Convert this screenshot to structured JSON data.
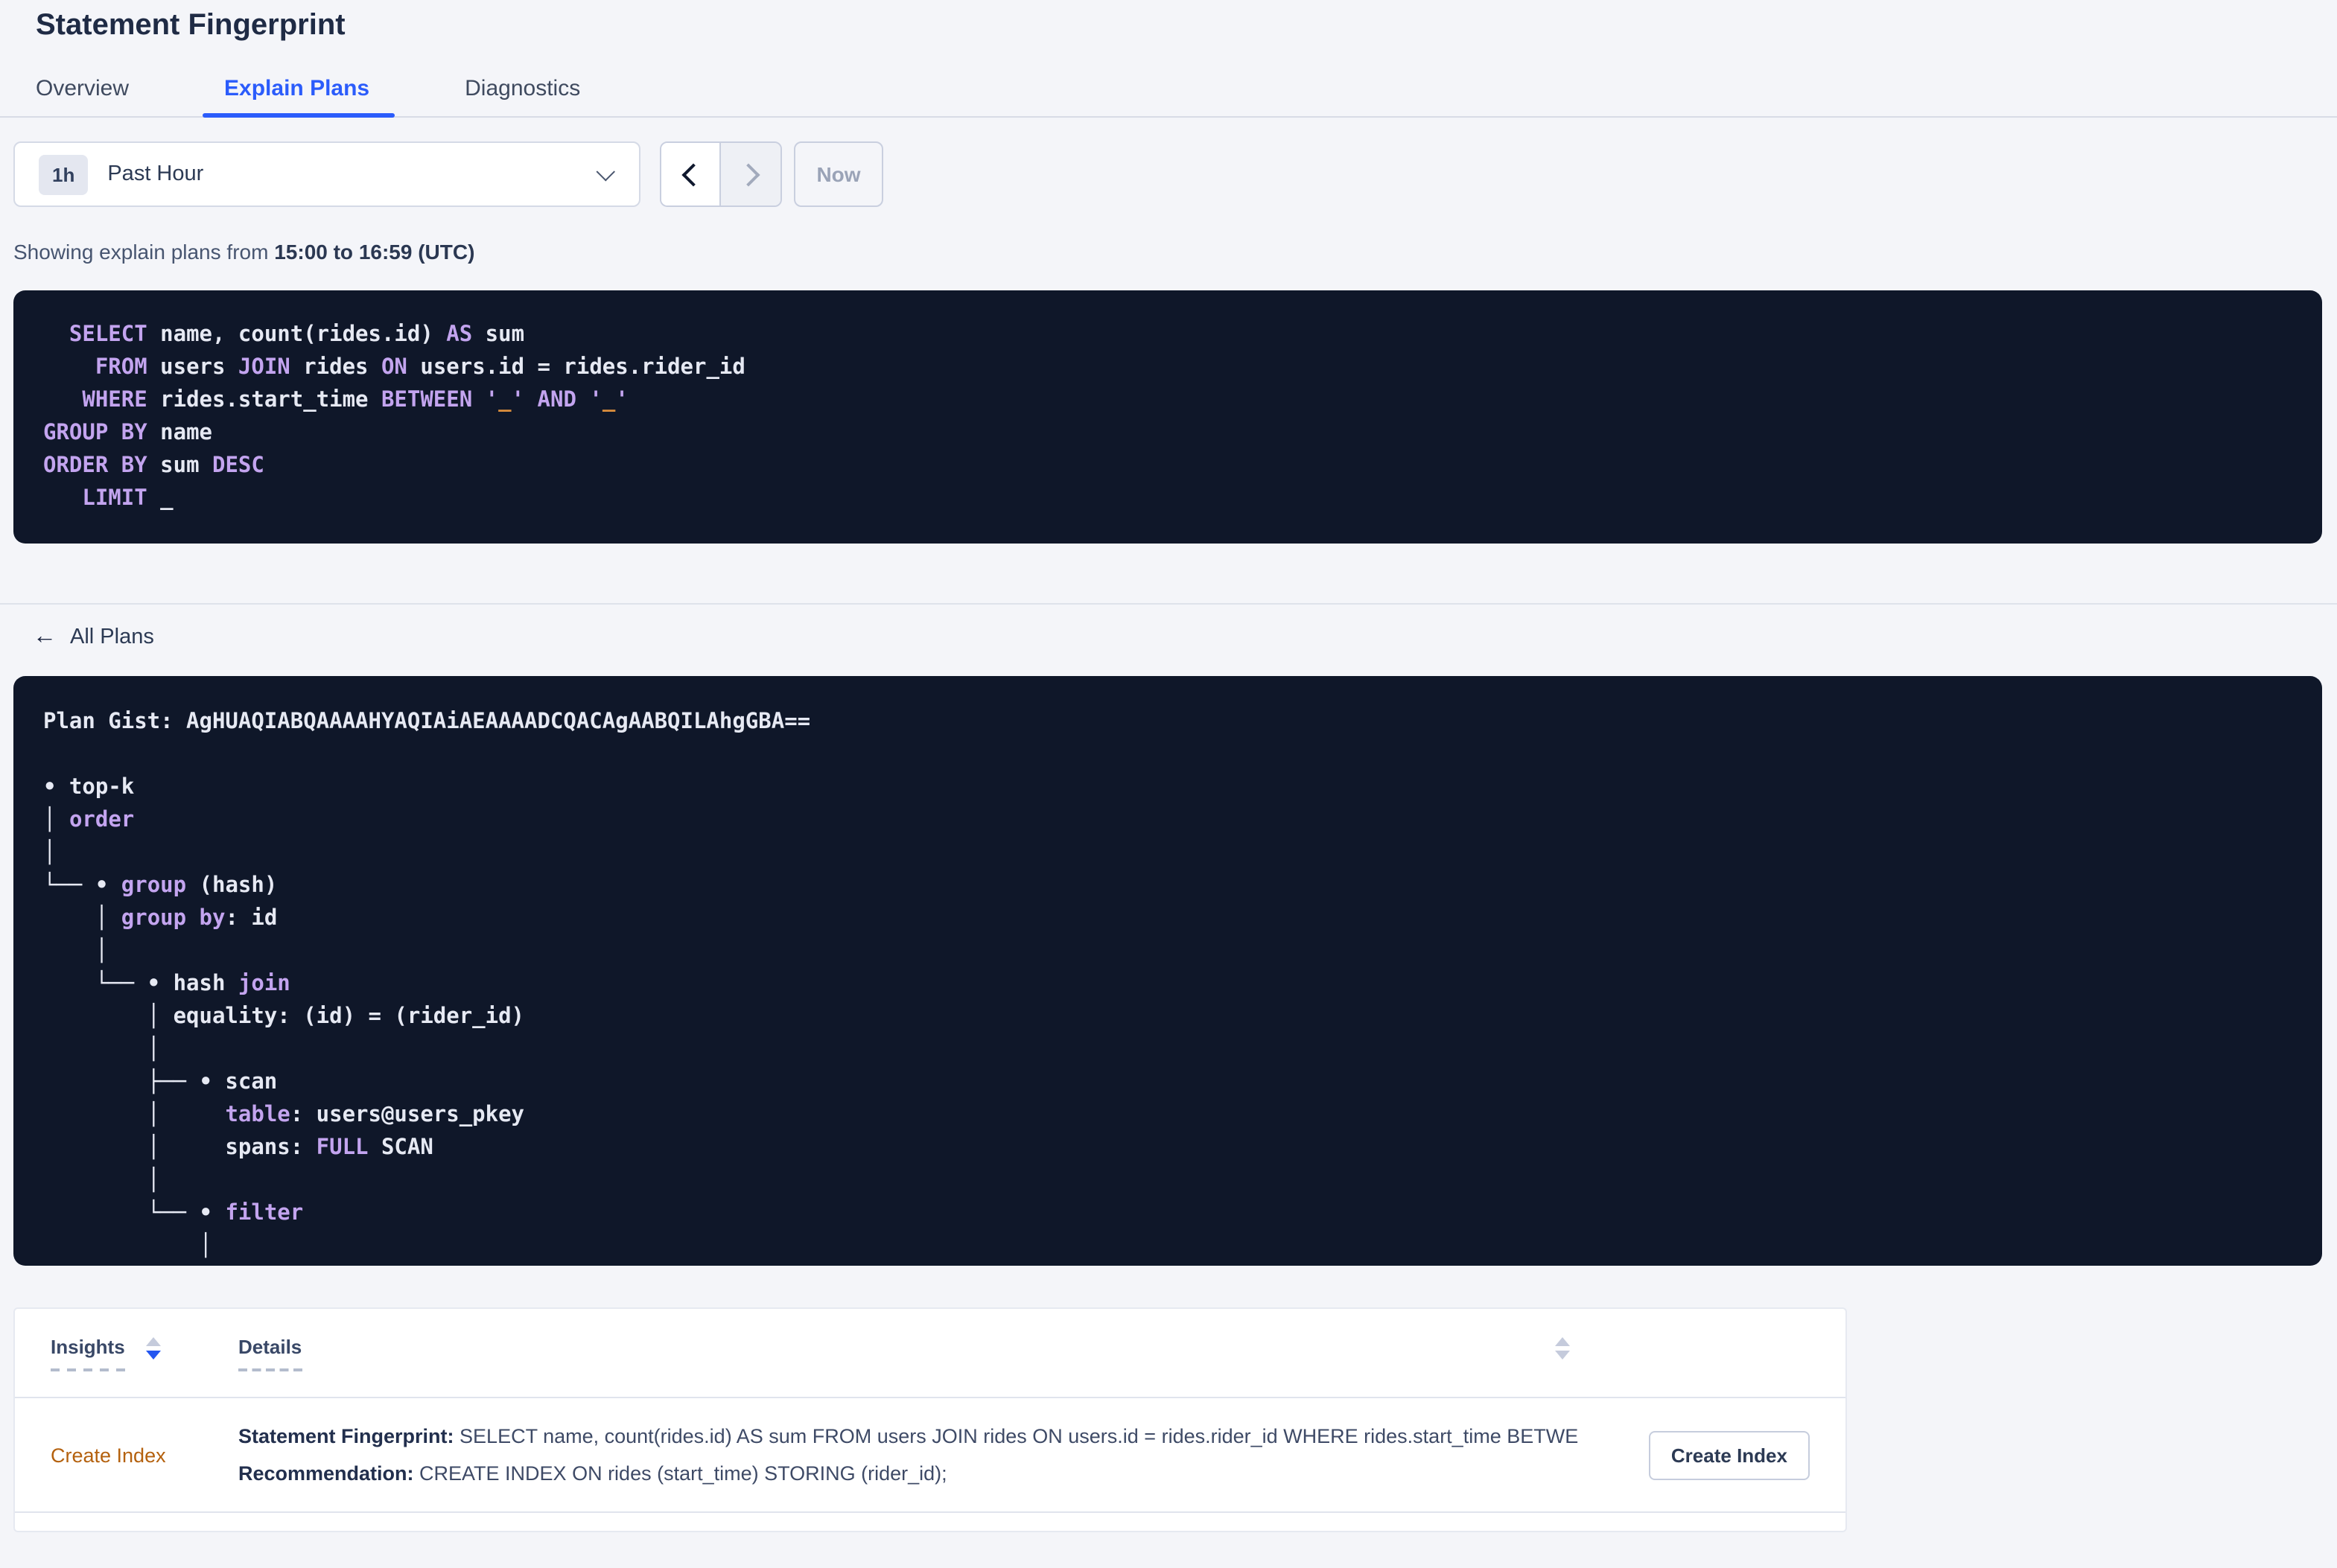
{
  "page_title": "Statement Fingerprint",
  "tabs": [
    {
      "label": "Overview"
    },
    {
      "label": "Explain Plans"
    },
    {
      "label": "Diagnostics"
    }
  ],
  "active_tab": "Explain Plans",
  "time_picker": {
    "badge": "1h",
    "label": "Past Hour",
    "now_label": "Now"
  },
  "showing": {
    "prefix": "Showing explain plans from ",
    "range": "15:00 to 16:59 (UTC)"
  },
  "icons": {
    "back_arrow": "←",
    "chevron_down": "chevron-down",
    "prev_chevron": "chevron-left",
    "next_chevron": "chevron-right"
  },
  "all_plans_label": "All Plans",
  "sql_statement": {
    "lines": [
      [
        [
          "k",
          "  SELECT"
        ],
        [
          "w",
          " name, count(rides.id) "
        ],
        [
          "k",
          "AS"
        ],
        [
          "w",
          " sum"
        ]
      ],
      [
        [
          "k",
          "    FROM"
        ],
        [
          "w",
          " users "
        ],
        [
          "k",
          "JOIN"
        ],
        [
          "w",
          " rides "
        ],
        [
          "k",
          "ON"
        ],
        [
          "w",
          " users.id = rides.rider_id"
        ]
      ],
      [
        [
          "k",
          "   WHERE"
        ],
        [
          "w",
          " rides.start_time "
        ],
        [
          "k",
          "BETWEEN"
        ],
        [
          "w",
          " "
        ],
        [
          "k",
          "'"
        ],
        [
          "o",
          "_"
        ],
        [
          "k",
          "'"
        ],
        [
          "w",
          " "
        ],
        [
          "k",
          "AND"
        ],
        [
          "w",
          " "
        ],
        [
          "k",
          "'"
        ],
        [
          "o",
          "_"
        ],
        [
          "k",
          "'"
        ]
      ],
      [
        [
          "k",
          "GROUP BY"
        ],
        [
          "w",
          " name"
        ]
      ],
      [
        [
          "k",
          "ORDER BY"
        ],
        [
          "w",
          " sum "
        ],
        [
          "k",
          "DESC"
        ]
      ],
      [
        [
          "k",
          "   LIMIT"
        ],
        [
          "w",
          " _"
        ]
      ]
    ]
  },
  "plan": {
    "lines": [
      [
        [
          "w",
          "Plan Gist: AgHUAQIABQAAAAHYAQIAiAEAAAADCQACAgAABQILAhgGBA=="
        ]
      ],
      [],
      [
        [
          "w",
          "• top-k"
        ]
      ],
      [
        [
          "w",
          "│ "
        ],
        [
          "k",
          "order"
        ]
      ],
      [
        [
          "w",
          "│"
        ]
      ],
      [
        [
          "w",
          "└── • "
        ],
        [
          "k",
          "group"
        ],
        [
          "w",
          " (hash)"
        ]
      ],
      [
        [
          "w",
          "    │ "
        ],
        [
          "k",
          "group by"
        ],
        [
          "w",
          ": id"
        ]
      ],
      [
        [
          "w",
          "    │"
        ]
      ],
      [
        [
          "w",
          "    └── • hash "
        ],
        [
          "k",
          "join"
        ]
      ],
      [
        [
          "w",
          "        │ equality: (id) = (rider_id)"
        ]
      ],
      [
        [
          "w",
          "        │"
        ]
      ],
      [
        [
          "w",
          "        ├── • scan"
        ]
      ],
      [
        [
          "w",
          "        │     "
        ],
        [
          "k",
          "table"
        ],
        [
          "w",
          ": users@users_pkey"
        ]
      ],
      [
        [
          "w",
          "        │     spans: "
        ],
        [
          "k",
          "FULL"
        ],
        [
          "w",
          " SCAN"
        ]
      ],
      [
        [
          "w",
          "        │"
        ]
      ],
      [
        [
          "w",
          "        └── • "
        ],
        [
          "k",
          "filter"
        ]
      ],
      [
        [
          "w",
          "            │"
        ]
      ]
    ]
  },
  "insights_table": {
    "columns": [
      "Insights",
      "Details"
    ],
    "rows": [
      {
        "insight": "Create Index",
        "statement_label": "Statement Fingerprint:",
        "statement": " SELECT name, count(rides.id) AS sum FROM users JOIN rides ON users.id = rides.rider_id WHERE rides.start_time BETWEEN '_…",
        "recommendation_label": "Recommendation:",
        "recommendation": " CREATE INDEX ON rides (start_time) STORING (rider_id);",
        "action_label": "Create Index"
      }
    ]
  },
  "colors": {
    "accent_blue": "#2b5cfb",
    "dark_panel_bg": "#0f1729",
    "code_keyword": "#c3a4ef",
    "code_text": "#e6e9f3",
    "code_literal": "#dd8f3d",
    "insight_orange": "#b4610e",
    "page_bg": "#f4f5f9"
  }
}
